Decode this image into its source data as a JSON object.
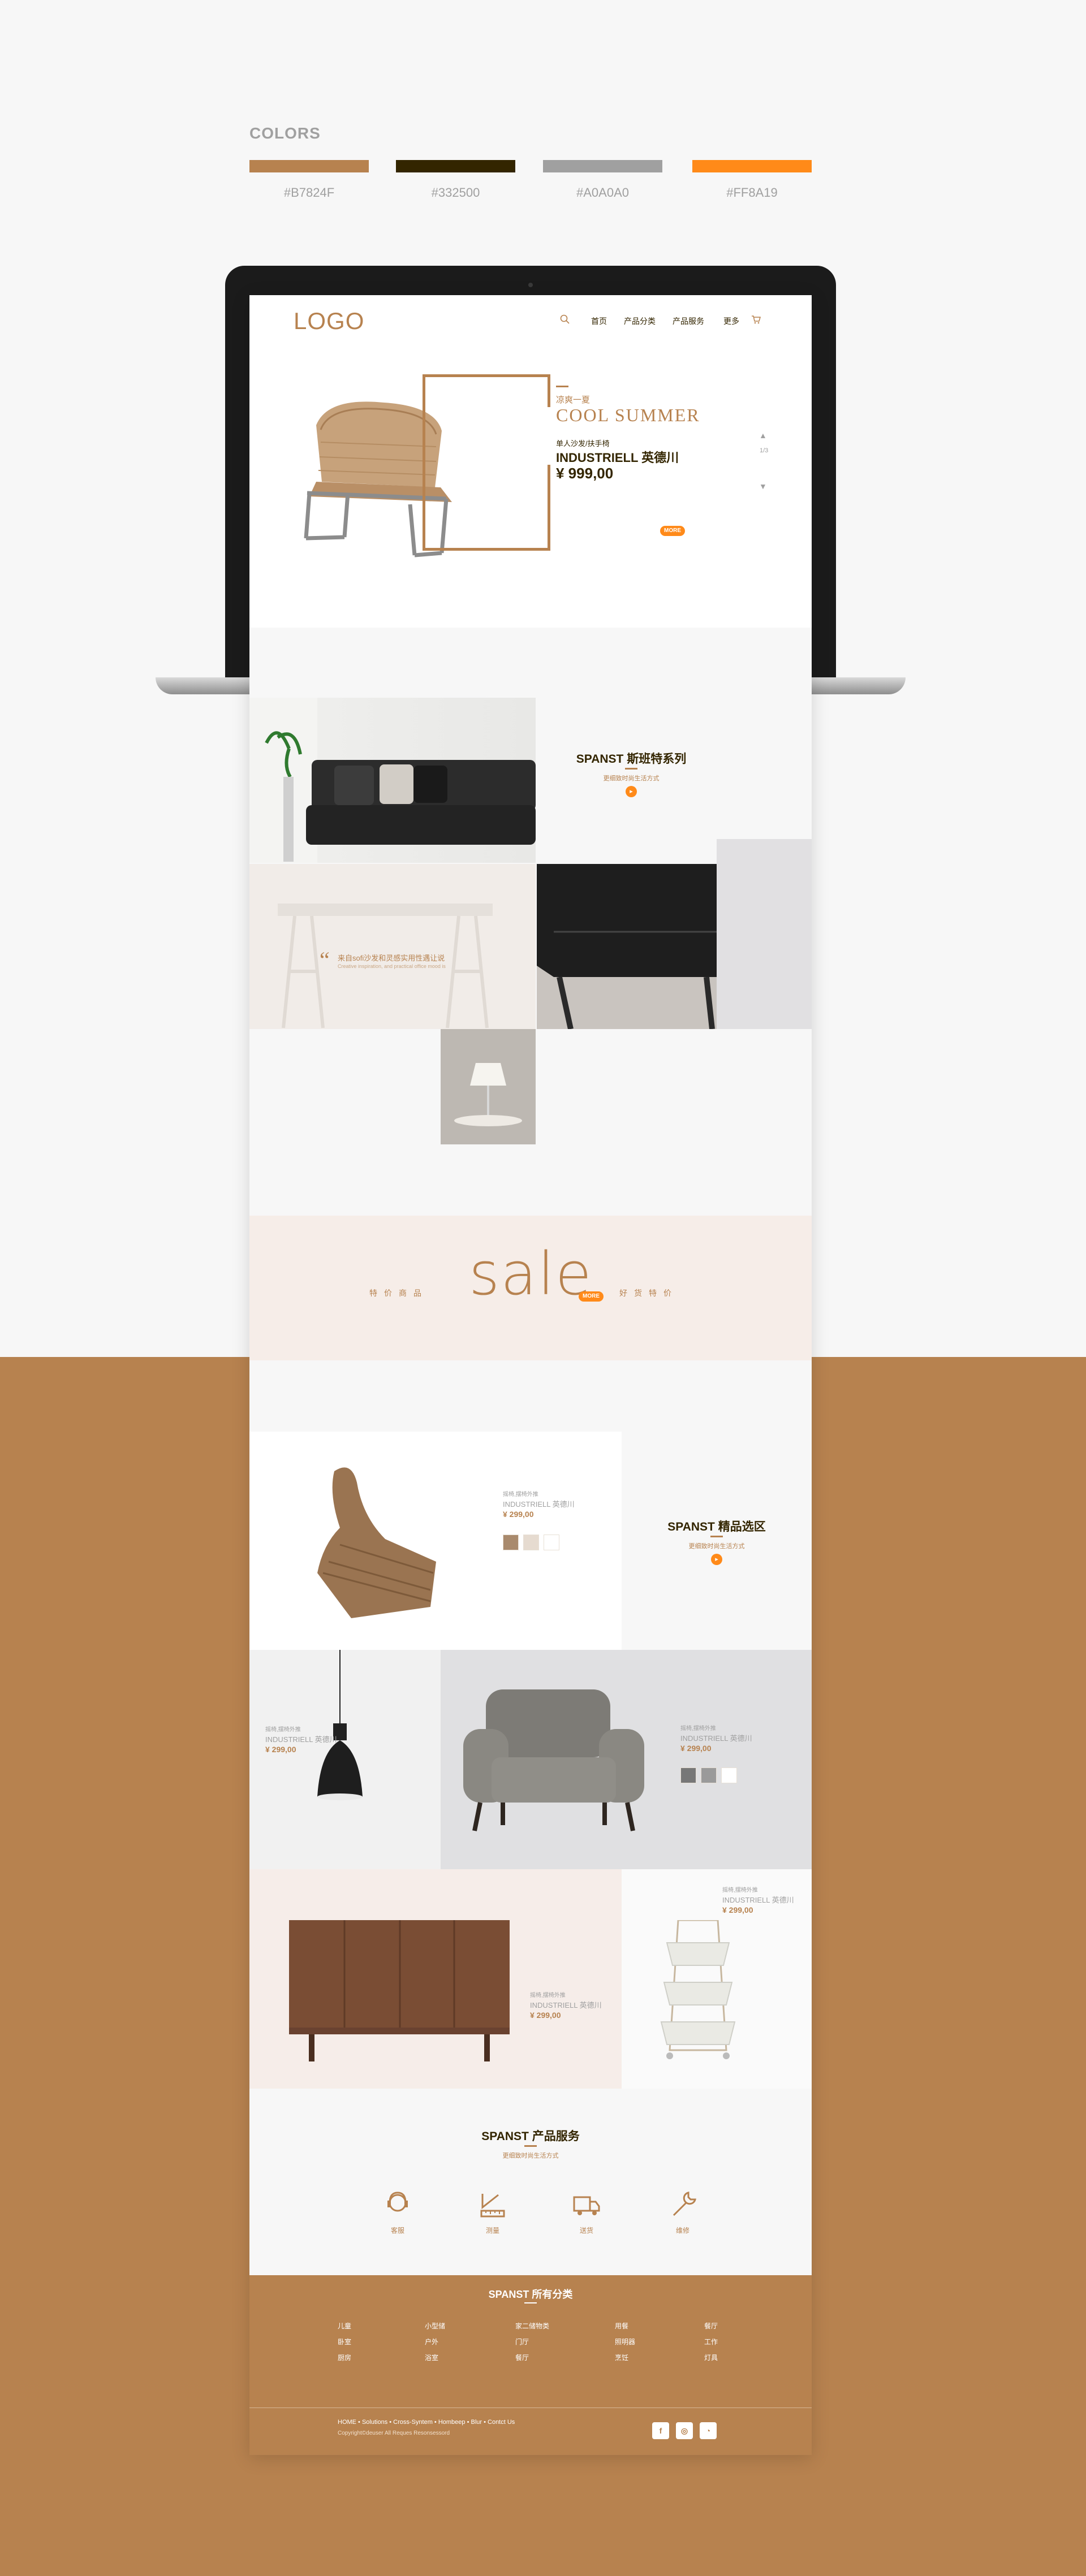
{
  "colors": {
    "title": "COLORS",
    "swatches": [
      {
        "hex": "#B7824F",
        "label": "#B7824F"
      },
      {
        "hex": "#332500",
        "label": "#332500"
      },
      {
        "hex": "#A0A0A0",
        "label": "#A0A0A0"
      },
      {
        "hex": "#FF8A19",
        "label": "#FF8A19"
      }
    ]
  },
  "header": {
    "logo": "LOGO",
    "nav": [
      "首页",
      "产品分类",
      "产品服务",
      "更多"
    ]
  },
  "hero": {
    "sub": "凉爽一夏",
    "title": "COOL SUMMER",
    "small": "单人沙发/扶手椅",
    "name": "INDUSTRIELL 英德川",
    "price": "¥ 999,00",
    "more": "MORE",
    "pager": "1/3"
  },
  "series": {
    "title": "SPANST 斯班特系列",
    "sub": "更细致时尚生活方式"
  },
  "desk": {
    "text": "来自sofi沙发和灵感实用性遇让说",
    "text2": "Creative inspiration, and practical office mood is"
  },
  "sale": {
    "word": "sale",
    "more": "MORE",
    "left": "特价商品",
    "right": "好货特价"
  },
  "products": {
    "p1": {
      "cat": "摇椅,摆椅外推",
      "name": "INDUSTRIELL 英德川",
      "price": "¥ 299,00"
    },
    "side": {
      "title": "SPANST 精品选区",
      "sub": "更细致时尚生活方式"
    },
    "p2": {
      "cat": "摇椅,摆椅外推",
      "name": "INDUSTRIELL 英德川",
      "price": "¥ 299,00"
    },
    "p3": {
      "cat": "摇椅,摆椅外推",
      "name": "INDUSTRIELL 英德川",
      "price": "¥ 299,00"
    },
    "p4": {
      "cat": "摇椅,摆椅外推",
      "name": "INDUSTRIELL 英德川",
      "price": "¥ 299,00"
    },
    "p5": {
      "cat": "摇椅,摆椅外推",
      "name": "INDUSTRIELL 英德川",
      "price": "¥ 299,00"
    }
  },
  "services": {
    "title": "SPANST 产品服务",
    "sub": "更细致时尚生活方式",
    "items": [
      "客服",
      "测量",
      "送货",
      "维修"
    ]
  },
  "footer": {
    "title": "SPANST 所有分类",
    "columns": [
      [
        "儿童",
        "卧室",
        "厨房"
      ],
      [
        "小型储",
        "户外",
        "浴室"
      ],
      [
        "家二储物类",
        "门厅",
        "餐厅"
      ],
      [
        "用餐",
        "照明器",
        "烹饪"
      ],
      [
        "餐厅",
        "工作",
        "灯具"
      ]
    ],
    "links": "HOME • Solutions • Cross-Syntem • Hombeep • Blur • Contct Us",
    "copy": "Copyright©deuser All Reques Resonsessord"
  }
}
